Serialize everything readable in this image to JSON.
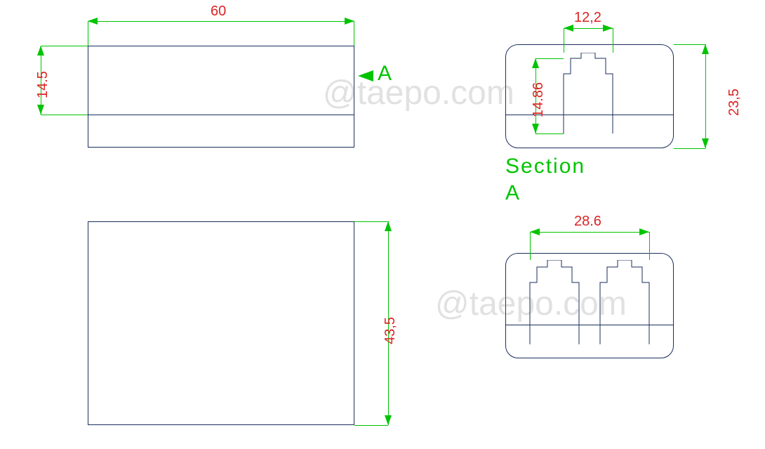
{
  "dims": {
    "width_60": "60",
    "height_14_5": "14.5",
    "top_right_w": "12,2",
    "top_right_h1": "14.86",
    "top_right_h2": "23,5",
    "bottom_left_h": "43,5",
    "bottom_right_w": "28.6"
  },
  "labels": {
    "section": "Section",
    "section_letter": "A",
    "callout_letter": "A"
  },
  "watermark": "@taepo.com"
}
